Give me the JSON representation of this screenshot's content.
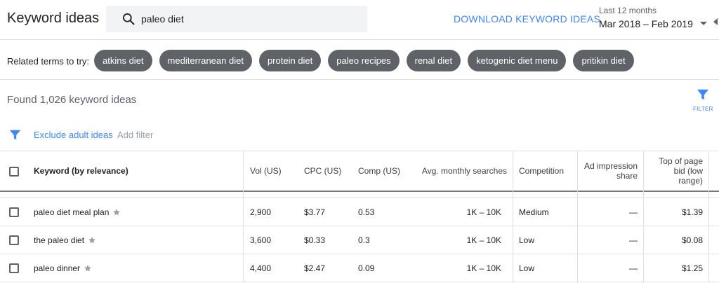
{
  "header": {
    "title": "Keyword ideas",
    "search_value": "paleo diet",
    "download_label": "DOWNLOAD KEYWORD IDEAS",
    "date_label": "Last 12 months",
    "date_value": "Mar 2018 – Feb 2019"
  },
  "related": {
    "label": "Related terms to try:",
    "chips": [
      "atkins diet",
      "mediterranean diet",
      "protein diet",
      "paleo recipes",
      "renal diet",
      "ketogenic diet menu",
      "pritikin diet"
    ]
  },
  "results": {
    "found_text": "Found 1,026 keyword ideas",
    "filter_label": "FILTER"
  },
  "filterbar": {
    "exclude_label": "Exclude adult ideas",
    "add_filter_label": "Add filter"
  },
  "table": {
    "columns": {
      "keyword": "Keyword (by relevance)",
      "vol": "Vol (US)",
      "cpc": "CPC (US)",
      "comp": "Comp (US)",
      "avg": "Avg. monthly searches",
      "competition": "Competition",
      "ad_share": "Ad impression share",
      "top_bid": "Top of page bid (low range)"
    },
    "rows": [
      {
        "keyword": "paleo diet meal plan",
        "vol": "2,900",
        "cpc": "$3.77",
        "comp": "0.53",
        "avg": "1K – 10K",
        "competition": "Medium",
        "ad_share": "—",
        "top_bid": "$1.39"
      },
      {
        "keyword": "the paleo diet",
        "vol": "3,600",
        "cpc": "$0.33",
        "comp": "0.3",
        "avg": "1K – 10K",
        "competition": "Low",
        "ad_share": "—",
        "top_bid": "$0.08"
      },
      {
        "keyword": "paleo dinner",
        "vol": "4,400",
        "cpc": "$2.47",
        "comp": "0.09",
        "avg": "1K – 10K",
        "competition": "Low",
        "ad_share": "—",
        "top_bid": "$1.25"
      }
    ]
  },
  "colors": {
    "accent": "#4285f4",
    "chip_bg": "#5f6368",
    "search_bg": "#f1f3f4"
  }
}
